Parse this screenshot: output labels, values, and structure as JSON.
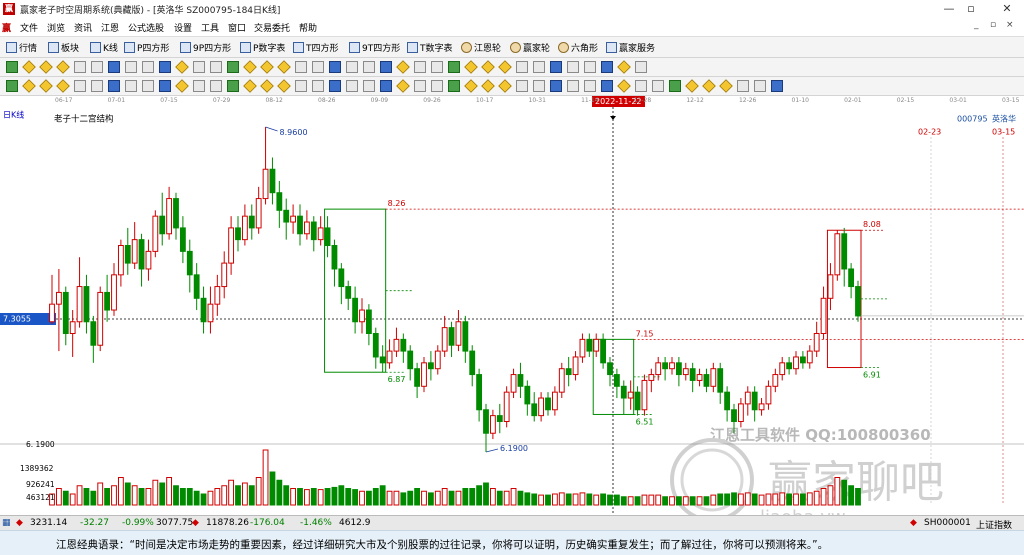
{
  "window": {
    "title": "赢家老子时空周期系统(典藏版) - [英洛华  SZ000795-184日K线]",
    "controls": [
      "—",
      "▫",
      "✕"
    ],
    "mdi_controls": [
      "_",
      "▫",
      "×"
    ]
  },
  "menu": {
    "logo": "赢",
    "items": [
      "文件",
      "浏览",
      "资讯",
      "江恩",
      "公式选股",
      "设置",
      "工具",
      "窗口",
      "交易委托",
      "帮助"
    ]
  },
  "toolbar1": {
    "items": [
      "行情",
      "板块",
      "K线",
      "P四方形",
      "9P四方形",
      "P数字表",
      "T四方形",
      "9T四方形",
      "T数字表",
      "江恩轮",
      "赢家轮",
      "六角形",
      "赢家服务"
    ]
  },
  "time_axis": {
    "labels": [
      "06-17",
      "07-01",
      "07-15",
      "07-29",
      "08-12",
      "08-26",
      "09-09",
      "09-26",
      "10-17",
      "10-31",
      "11-14",
      "11-28",
      "12-12",
      "12-26",
      "01-10",
      "02-01",
      "02-15",
      "03-01",
      "03-15"
    ],
    "cursor_date": "2022-11-22"
  },
  "chart": {
    "period_label": "日K线",
    "indicator_title": "老子十二宫结构",
    "stock_code": "000795",
    "stock_name": "英洛华",
    "future_dates": [
      "02-23",
      "03-15"
    ],
    "crosshair_price": "7.3055",
    "annotations": {
      "high": "8.9600",
      "low": "6.1900",
      "box1_top": "8.26",
      "box1_bottom": "6.87",
      "box2_top": "7.15",
      "box2_bottom": "6.51",
      "box3_top": "8.08",
      "box3_bottom": "6.91"
    },
    "price_axis_min_label": "6. 1900",
    "volume_axis": [
      "1389362",
      "926241",
      "463121"
    ],
    "watermark_small": "江恩工具软件  QQ:100800360",
    "watermark_big": "赢家聊吧",
    "watermark_url": "liaoba.yw"
  },
  "chart_data": {
    "type": "candlestick",
    "title": "老子十二宫结构",
    "ylabel": "",
    "price_range": [
      6.19,
      8.96
    ],
    "candles": [
      [
        7.3,
        7.45,
        7.28,
        7.7,
        1
      ],
      [
        7.45,
        7.55,
        7.05,
        7.75,
        1
      ],
      [
        7.55,
        7.2,
        7.1,
        7.6,
        -1
      ],
      [
        7.2,
        7.3,
        7.0,
        7.4,
        1
      ],
      [
        7.3,
        7.6,
        7.25,
        7.85,
        1
      ],
      [
        7.6,
        7.3,
        7.2,
        7.7,
        -1
      ],
      [
        7.3,
        7.1,
        6.95,
        7.35,
        -1
      ],
      [
        7.1,
        7.55,
        7.05,
        7.6,
        1
      ],
      [
        7.55,
        7.4,
        7.3,
        7.7,
        -1
      ],
      [
        7.4,
        7.7,
        7.35,
        7.8,
        1
      ],
      [
        7.7,
        7.95,
        7.6,
        8.0,
        1
      ],
      [
        7.95,
        7.8,
        7.7,
        8.1,
        -1
      ],
      [
        7.8,
        8.0,
        7.75,
        8.15,
        1
      ],
      [
        8.0,
        7.75,
        7.6,
        8.05,
        -1
      ],
      [
        7.75,
        7.9,
        7.65,
        8.0,
        1
      ],
      [
        7.9,
        8.2,
        7.85,
        8.25,
        1
      ],
      [
        8.2,
        8.05,
        7.95,
        8.4,
        -1
      ],
      [
        8.05,
        8.35,
        8.0,
        8.45,
        1
      ],
      [
        8.35,
        8.1,
        8.0,
        8.4,
        -1
      ],
      [
        8.1,
        7.9,
        7.8,
        8.2,
        -1
      ],
      [
        7.9,
        7.7,
        7.55,
        8.0,
        -1
      ],
      [
        7.7,
        7.5,
        7.4,
        7.8,
        -1
      ],
      [
        7.5,
        7.3,
        7.2,
        7.6,
        -1
      ],
      [
        7.3,
        7.45,
        7.2,
        7.6,
        1
      ],
      [
        7.45,
        7.6,
        7.35,
        7.7,
        1
      ],
      [
        7.6,
        7.8,
        7.5,
        7.9,
        1
      ],
      [
        7.8,
        8.1,
        7.7,
        8.2,
        1
      ],
      [
        8.1,
        8.0,
        7.9,
        8.2,
        -1
      ],
      [
        8.0,
        8.2,
        7.95,
        8.3,
        1
      ],
      [
        8.2,
        8.1,
        8.0,
        8.3,
        -1
      ],
      [
        8.1,
        8.35,
        8.05,
        8.45,
        1
      ],
      [
        8.35,
        8.6,
        8.3,
        8.96,
        1
      ],
      [
        8.6,
        8.4,
        8.3,
        8.7,
        -1
      ],
      [
        8.4,
        8.25,
        8.1,
        8.5,
        -1
      ],
      [
        8.25,
        8.15,
        8.0,
        8.35,
        -1
      ],
      [
        8.15,
        8.2,
        8.05,
        8.3,
        1
      ],
      [
        8.2,
        8.05,
        7.95,
        8.3,
        -1
      ],
      [
        8.05,
        8.15,
        8.0,
        8.25,
        1
      ],
      [
        8.15,
        8.0,
        7.9,
        8.2,
        -1
      ],
      [
        8.0,
        8.1,
        7.95,
        8.2,
        1
      ],
      [
        8.1,
        7.95,
        7.85,
        8.2,
        -1
      ],
      [
        7.95,
        7.75,
        7.6,
        8.0,
        -1
      ],
      [
        7.75,
        7.6,
        7.45,
        7.8,
        -1
      ],
      [
        7.6,
        7.5,
        7.4,
        7.65,
        -1
      ],
      [
        7.5,
        7.3,
        7.2,
        7.6,
        -1
      ],
      [
        7.3,
        7.4,
        7.2,
        7.5,
        1
      ],
      [
        7.4,
        7.2,
        7.1,
        7.45,
        -1
      ],
      [
        7.2,
        7.0,
        6.9,
        7.25,
        -1
      ],
      [
        7.0,
        6.95,
        6.87,
        7.1,
        -1
      ],
      [
        6.95,
        7.05,
        6.9,
        7.15,
        1
      ],
      [
        7.05,
        7.15,
        7.0,
        7.25,
        1
      ],
      [
        7.15,
        7.05,
        6.95,
        7.2,
        -1
      ],
      [
        7.05,
        6.9,
        6.8,
        7.1,
        -1
      ],
      [
        6.9,
        6.75,
        6.65,
        6.95,
        -1
      ],
      [
        6.75,
        6.95,
        6.7,
        7.0,
        1
      ],
      [
        6.95,
        6.9,
        6.8,
        7.05,
        -1
      ],
      [
        6.9,
        7.05,
        6.85,
        7.1,
        1
      ],
      [
        7.05,
        7.25,
        7.0,
        7.35,
        1
      ],
      [
        7.25,
        7.1,
        7.0,
        7.3,
        -1
      ],
      [
        7.1,
        7.3,
        7.05,
        7.4,
        1
      ],
      [
        7.3,
        7.05,
        6.95,
        7.35,
        -1
      ],
      [
        7.05,
        6.85,
        6.75,
        7.1,
        -1
      ],
      [
        6.85,
        6.55,
        6.45,
        6.9,
        -1
      ],
      [
        6.55,
        6.35,
        6.19,
        6.6,
        -1
      ],
      [
        6.35,
        6.5,
        6.3,
        6.55,
        1
      ],
      [
        6.5,
        6.45,
        6.35,
        6.6,
        -1
      ],
      [
        6.45,
        6.7,
        6.4,
        6.75,
        1
      ],
      [
        6.7,
        6.85,
        6.65,
        6.9,
        1
      ],
      [
        6.85,
        6.75,
        6.65,
        6.95,
        -1
      ],
      [
        6.75,
        6.6,
        6.5,
        6.8,
        -1
      ],
      [
        6.6,
        6.5,
        6.45,
        6.7,
        -1
      ],
      [
        6.5,
        6.65,
        6.45,
        6.7,
        1
      ],
      [
        6.65,
        6.55,
        6.5,
        6.7,
        -1
      ],
      [
        6.55,
        6.7,
        6.5,
        6.75,
        1
      ],
      [
        6.7,
        6.9,
        6.65,
        6.95,
        1
      ],
      [
        6.9,
        6.85,
        6.75,
        7.0,
        -1
      ],
      [
        6.85,
        7.0,
        6.8,
        7.05,
        1
      ],
      [
        7.0,
        7.15,
        6.95,
        7.2,
        1
      ],
      [
        7.15,
        7.05,
        7.0,
        7.2,
        -1
      ],
      [
        7.05,
        7.15,
        7.0,
        7.2,
        1
      ],
      [
        7.15,
        6.95,
        6.9,
        7.2,
        -1
      ],
      [
        6.95,
        6.85,
        6.75,
        7.0,
        -1
      ],
      [
        6.85,
        6.75,
        6.65,
        6.9,
        -1
      ],
      [
        6.75,
        6.65,
        6.51,
        6.8,
        -1
      ],
      [
        6.65,
        6.7,
        6.55,
        6.8,
        1
      ],
      [
        6.7,
        6.55,
        6.5,
        6.75,
        -1
      ],
      [
        6.55,
        6.8,
        6.5,
        6.85,
        1
      ],
      [
        6.8,
        6.85,
        6.7,
        6.9,
        1
      ],
      [
        6.85,
        6.95,
        6.8,
        7.0,
        1
      ],
      [
        6.95,
        6.9,
        6.8,
        7.0,
        -1
      ],
      [
        6.9,
        6.95,
        6.85,
        7.0,
        1
      ],
      [
        6.95,
        6.85,
        6.75,
        7.0,
        -1
      ],
      [
        6.85,
        6.9,
        6.8,
        6.95,
        1
      ],
      [
        6.9,
        6.8,
        6.7,
        6.95,
        -1
      ],
      [
        6.8,
        6.85,
        6.75,
        6.9,
        1
      ],
      [
        6.85,
        6.75,
        6.7,
        6.9,
        -1
      ],
      [
        6.75,
        6.9,
        6.7,
        6.95,
        1
      ],
      [
        6.9,
        6.7,
        6.6,
        6.95,
        -1
      ],
      [
        6.7,
        6.55,
        6.45,
        6.75,
        -1
      ],
      [
        6.55,
        6.45,
        6.35,
        6.6,
        -1
      ],
      [
        6.45,
        6.6,
        6.4,
        6.65,
        1
      ],
      [
        6.6,
        6.7,
        6.5,
        6.75,
        1
      ],
      [
        6.7,
        6.55,
        6.45,
        6.75,
        -1
      ],
      [
        6.55,
        6.6,
        6.5,
        6.65,
        1
      ],
      [
        6.6,
        6.75,
        6.55,
        6.8,
        1
      ],
      [
        6.75,
        6.85,
        6.7,
        6.9,
        1
      ],
      [
        6.85,
        6.95,
        6.8,
        7.0,
        1
      ],
      [
        6.95,
        6.9,
        6.85,
        7.0,
        -1
      ],
      [
        6.9,
        7.0,
        6.85,
        7.05,
        1
      ],
      [
        7.0,
        6.95,
        6.9,
        7.05,
        -1
      ],
      [
        6.95,
        7.05,
        6.9,
        7.1,
        1
      ],
      [
        7.05,
        7.2,
        7.0,
        7.3,
        1
      ],
      [
        7.2,
        7.5,
        7.15,
        7.6,
        1
      ],
      [
        7.5,
        7.7,
        7.4,
        7.8,
        1
      ],
      [
        7.7,
        8.05,
        7.65,
        8.08,
        1
      ],
      [
        8.05,
        7.75,
        7.6,
        8.1,
        -1
      ],
      [
        7.75,
        7.6,
        7.5,
        7.8,
        -1
      ],
      [
        7.6,
        7.35,
        7.3,
        7.65,
        -1
      ]
    ],
    "volumes": [
      0.2,
      0.3,
      0.25,
      0.2,
      0.35,
      0.3,
      0.25,
      0.4,
      0.3,
      0.35,
      0.5,
      0.4,
      0.35,
      0.3,
      0.3,
      0.45,
      0.4,
      0.5,
      0.35,
      0.3,
      0.3,
      0.25,
      0.2,
      0.25,
      0.3,
      0.35,
      0.45,
      0.35,
      0.4,
      0.35,
      0.5,
      1.0,
      0.6,
      0.45,
      0.35,
      0.3,
      0.3,
      0.28,
      0.3,
      0.28,
      0.3,
      0.32,
      0.35,
      0.3,
      0.28,
      0.25,
      0.25,
      0.3,
      0.35,
      0.25,
      0.25,
      0.22,
      0.25,
      0.3,
      0.25,
      0.22,
      0.25,
      0.3,
      0.25,
      0.25,
      0.3,
      0.3,
      0.35,
      0.4,
      0.3,
      0.25,
      0.25,
      0.3,
      0.25,
      0.22,
      0.2,
      0.18,
      0.18,
      0.2,
      0.22,
      0.2,
      0.2,
      0.22,
      0.2,
      0.18,
      0.2,
      0.18,
      0.18,
      0.15,
      0.15,
      0.15,
      0.18,
      0.18,
      0.18,
      0.15,
      0.15,
      0.15,
      0.15,
      0.15,
      0.15,
      0.15,
      0.18,
      0.2,
      0.2,
      0.22,
      0.2,
      0.22,
      0.2,
      0.18,
      0.2,
      0.2,
      0.22,
      0.2,
      0.2,
      0.2,
      0.22,
      0.25,
      0.3,
      0.35,
      0.5,
      0.45,
      0.35,
      0.3
    ]
  },
  "status": {
    "sh_index": "3231.14",
    "sh_change": "-32.27",
    "sh_pct": "-0.99%",
    "sh_amt": "3077.75",
    "sz_index": "11878.26",
    "sz_change": "-176.04",
    "sz_pct": "-1.46%",
    "sz_amt": "4612.9",
    "right_code": "SH000001",
    "right_name": "上证指数"
  },
  "quote": "江恩经典语录：“时间是决定市场走势的重要因素，经过详细研究大市及个别股票的过往记录，你将可以证明，历史确实重复发生；而了解过往，你将可以预测将来。”。"
}
